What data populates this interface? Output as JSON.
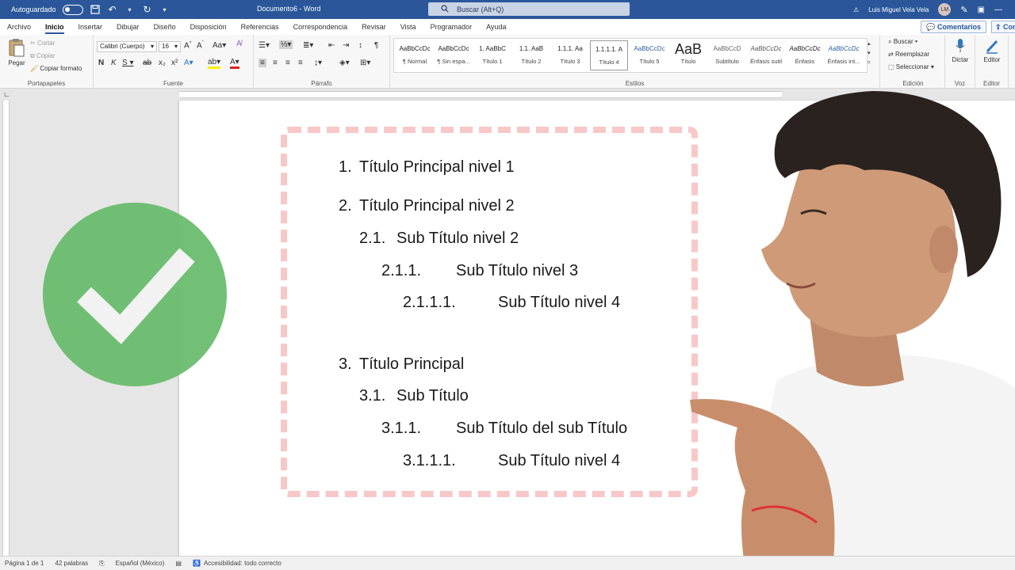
{
  "titlebar": {
    "autosave_label": "Autoguardado",
    "doc_title": "Documento6 - Word",
    "search_placeholder": "Buscar (Alt+Q)",
    "user_name": "Luis Miguel Vela Vela",
    "user_initials": "LM"
  },
  "tabs": [
    "Archivo",
    "Inicio",
    "Insertar",
    "Dibujar",
    "Diseño",
    "Disposición",
    "Referencias",
    "Correspondencia",
    "Revisar",
    "Vista",
    "Programador",
    "Ayuda"
  ],
  "active_tab": "Inicio",
  "comments_label": "Comentarios",
  "share_label": "Con",
  "clipboard": {
    "paste": "Pegar",
    "cut": "Cortar",
    "copy": "Copiar",
    "format_painter": "Copiar formato",
    "group": "Portapapeles"
  },
  "font": {
    "family": "Calibri (Cuerpo)",
    "size": "16",
    "group": "Fuente"
  },
  "paragraph": {
    "group": "Párrafo"
  },
  "styles": {
    "group": "Estilos",
    "items": [
      {
        "preview": "AaBbCcDc",
        "name": "¶ Normal"
      },
      {
        "preview": "AaBbCcDc",
        "name": "¶ Sin espa..."
      },
      {
        "preview": "1.  AaBbC",
        "name": "Título 1"
      },
      {
        "preview": "1.1.  AaB",
        "name": "Título 2"
      },
      {
        "preview": "1.1.1.  Aa",
        "name": "Título 3"
      },
      {
        "preview": "1.1.1.1.  A",
        "name": "Título 4"
      },
      {
        "preview": "AaBbCcDc",
        "name": "Título 5"
      },
      {
        "preview": "AaB",
        "name": "Título"
      },
      {
        "preview": "AaBbCcD",
        "name": "Subtítulo"
      },
      {
        "preview": "AaBbCcDc",
        "name": "Énfasis sutil"
      },
      {
        "preview": "AaBbCcDc",
        "name": "Énfasis"
      },
      {
        "preview": "AaBbCcDc",
        "name": "Énfasis int..."
      }
    ],
    "selected_index": 5
  },
  "editing": {
    "find": "Buscar",
    "replace": "Reemplazar",
    "select": "Seleccionar",
    "group": "Edición"
  },
  "voice": {
    "dictate": "Dictar",
    "group": "Voz"
  },
  "editor": {
    "label": "Editor",
    "group": "Editor"
  },
  "document_list": [
    {
      "num": "1.",
      "text": "Título Principal nivel 1",
      "level": 1
    },
    {
      "num": "2.",
      "text": "Título Principal nivel 2",
      "level": 1
    },
    {
      "num": "2.1.",
      "text": "Sub Título nivel 2",
      "level": 2
    },
    {
      "num": "2.1.1.",
      "text": "Sub Título nivel 3",
      "level": 3
    },
    {
      "num": "2.1.1.1.",
      "text": "Sub Título nivel 4",
      "level": 4
    },
    {
      "num": "3.",
      "text": "Título Principal",
      "level": 1
    },
    {
      "num": "3.1.",
      "text": "Sub Título",
      "level": 2
    },
    {
      "num": "3.1.1.",
      "text": "Sub Título del sub Título",
      "level": 3
    },
    {
      "num": "3.1.1.1.",
      "text": "Sub Título nivel 4",
      "level": 4
    }
  ],
  "statusbar": {
    "page": "Página 1 de 1",
    "words": "42 palabras",
    "language": "Español (México)",
    "accessibility": "Accesibilidad: todo correcto"
  },
  "colors": {
    "word_blue": "#2b579a",
    "frame_pink": "#f8c8c8",
    "check_green": "#66bb6a"
  }
}
